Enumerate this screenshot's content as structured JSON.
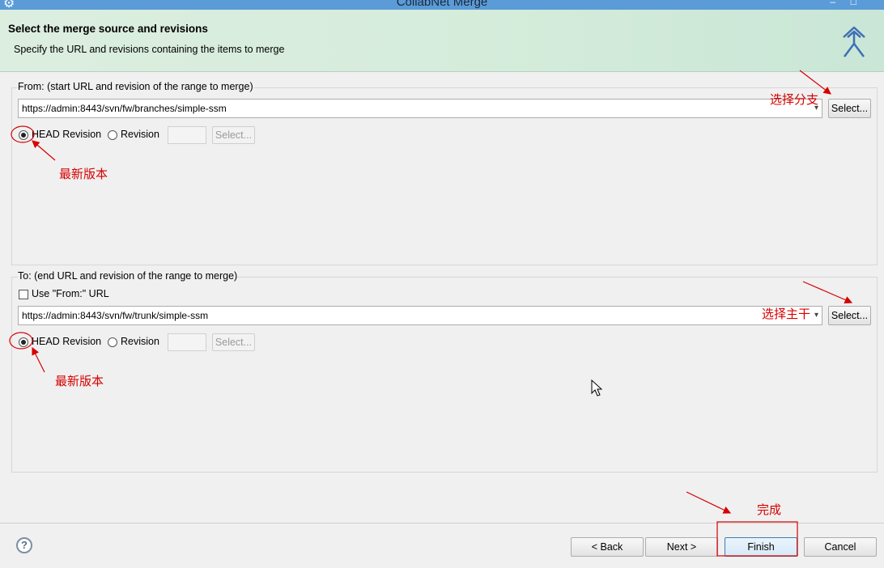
{
  "window": {
    "title": "CollabNet Merge"
  },
  "header": {
    "title": "Select the merge source and revisions",
    "subtitle": "Specify the URL and revisions containing the items to merge"
  },
  "from": {
    "label": "From: (start URL and revision of the range to merge)",
    "url": "https://admin:8443/svn/fw/branches/simple-ssm",
    "select_label": "Select...",
    "head_revision_label": "HEAD Revision",
    "revision_label": "Revision",
    "revision_value": "",
    "revision_select_label": "Select...",
    "head_selected": true
  },
  "to": {
    "label": "To: (end URL and revision of the range to merge)",
    "use_from_label": "Use \"From:\" URL",
    "use_from_checked": false,
    "url": "https://admin:8443/svn/fw/trunk/simple-ssm",
    "select_label": "Select...",
    "head_revision_label": "HEAD Revision",
    "revision_label": "Revision",
    "revision_value": "",
    "revision_select_label": "Select...",
    "head_selected": true
  },
  "footer": {
    "help_label": "?",
    "back_label": "< Back",
    "next_label": "Next >",
    "finish_label": "Finish",
    "cancel_label": "Cancel"
  },
  "annotations": {
    "select_branch": "选择分支",
    "latest_version_1": "最新版本",
    "select_trunk": "选择主干",
    "latest_version_2": "最新版本",
    "finish": "完成",
    "color": "#d60000"
  },
  "icons": {
    "app": "eclipse-gear-icon",
    "header": "merge-arrows-icon",
    "dropdown": "chevron-down-icon",
    "cursor": "mouse-pointer-icon"
  }
}
